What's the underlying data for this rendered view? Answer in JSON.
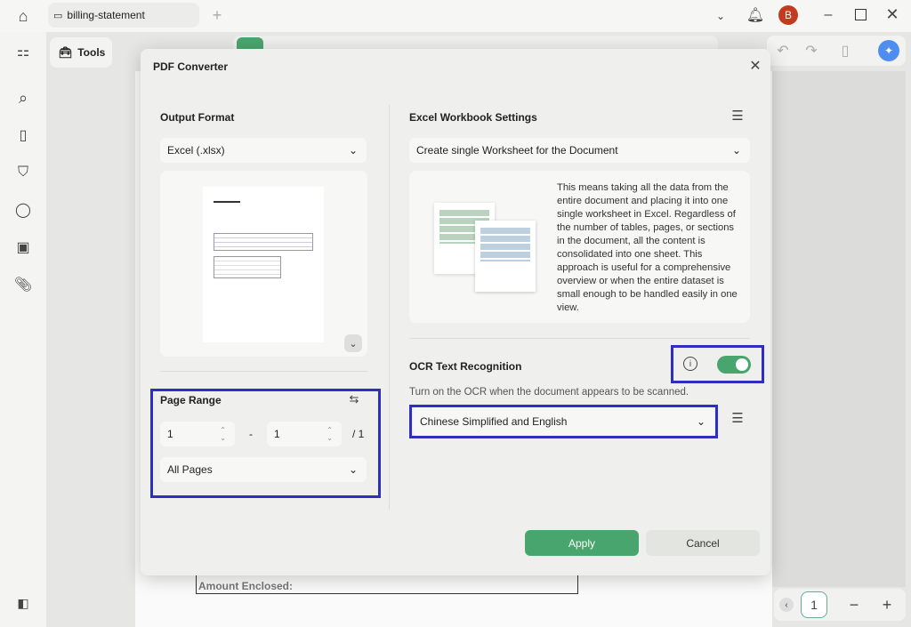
{
  "titlebar": {
    "tab_label": "billing-statement",
    "avatar_letter": "B"
  },
  "toolbar": {
    "tools_label": "Tools"
  },
  "document": {
    "amount_enclosed": "Amount Enclosed:"
  },
  "pager": {
    "page": "1"
  },
  "dialog": {
    "title": "PDF Converter",
    "output_format_label": "Output Format",
    "output_format_value": "Excel (.xlsx)",
    "page_range_label": "Page Range",
    "range_from": "1",
    "range_to": "1",
    "range_sep": "-",
    "range_total": "/ 1",
    "pages_select": "All Pages",
    "excel_settings_label": "Excel Workbook Settings",
    "worksheet_select": "Create single Worksheet for the Document",
    "description": "This means taking all the data from the entire document and placing it into one single worksheet in Excel. Regardless of the number of tables, pages, or sections in the document, all the content is consolidated into one sheet. This approach is useful for a comprehensive overview or when the entire dataset is small enough to be handled easily in one view.",
    "ocr_label": "OCR Text Recognition",
    "ocr_enabled": true,
    "ocr_hint": "Turn on the OCR when the document appears to be scanned.",
    "ocr_language": "Chinese Simplified and English",
    "apply_label": "Apply",
    "cancel_label": "Cancel",
    "accent": "#48a56e"
  }
}
